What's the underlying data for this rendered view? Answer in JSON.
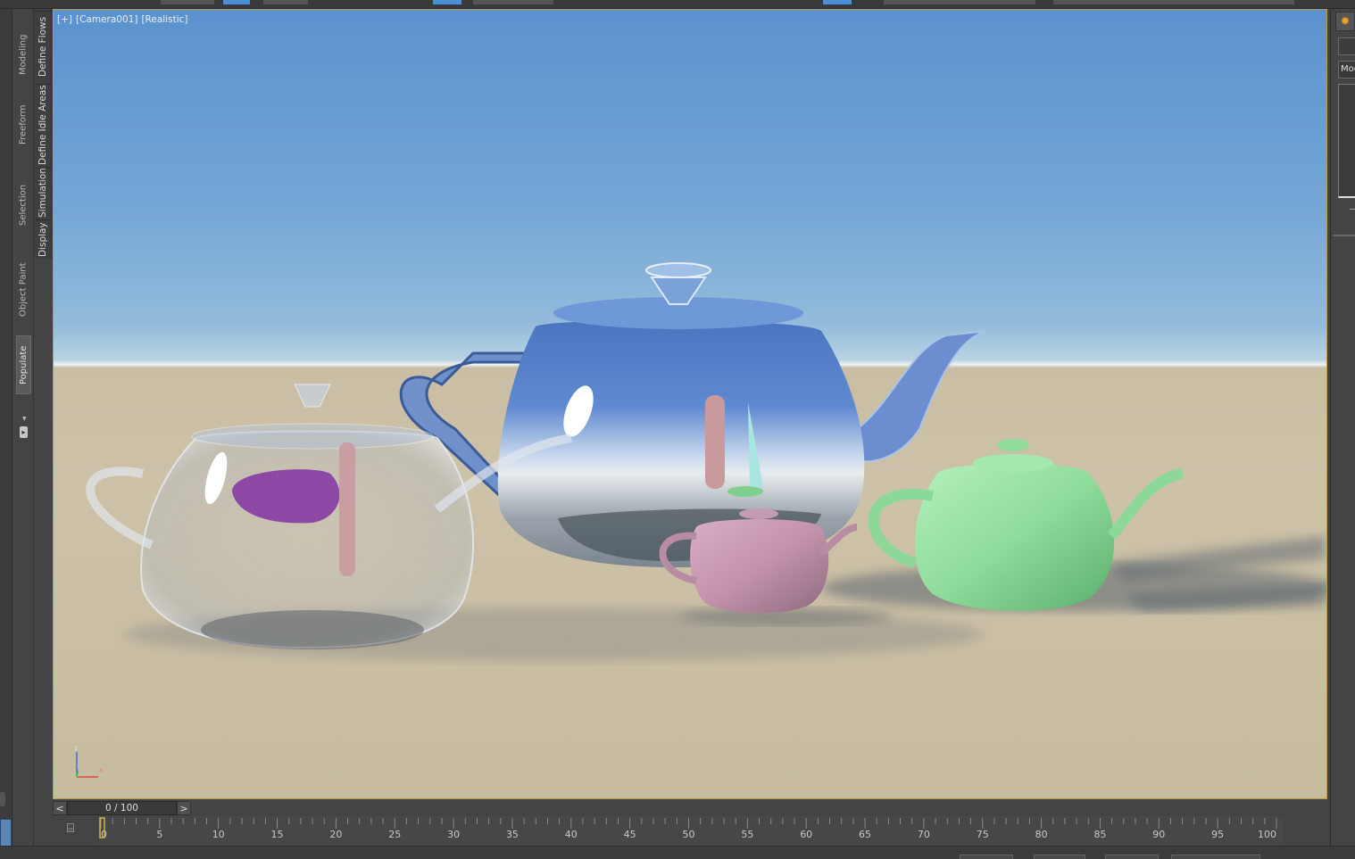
{
  "viewport": {
    "label_plus": "[+]",
    "label_camera": "[Camera001]",
    "label_mode": "[Realistic]",
    "axis_z": "z",
    "axis_x": "x"
  },
  "ribbon": {
    "tabs": [
      "Modeling",
      "Freeform",
      "Selection",
      "Object Paint",
      "Populate"
    ],
    "active_tab": "Populate",
    "sub_tabs": [
      "Define Flows",
      "Define Idle Areas",
      "Simulation",
      "Display"
    ]
  },
  "command_panel": {
    "modifier_label": "Mod"
  },
  "timeline": {
    "prev_label": "<",
    "next_label": ">",
    "frame_readout": "0 / 100",
    "current_frame": 0,
    "total_frames": 100,
    "tick_labels": [
      "0",
      "5",
      "10",
      "15",
      "20",
      "25",
      "30",
      "35",
      "40",
      "45",
      "50",
      "55",
      "60",
      "65",
      "70",
      "75",
      "80",
      "85",
      "90",
      "95",
      "100"
    ]
  },
  "colors": {
    "viewport_border": "#b49b4a",
    "time_marker": "#c8b450",
    "accent_blue": "#4a90d9",
    "render_light": "#f0a020"
  },
  "icons": {
    "render_setup": "sun-icon",
    "key_mode": "timeline-key-icon",
    "pin": "pin-stack-icon"
  }
}
